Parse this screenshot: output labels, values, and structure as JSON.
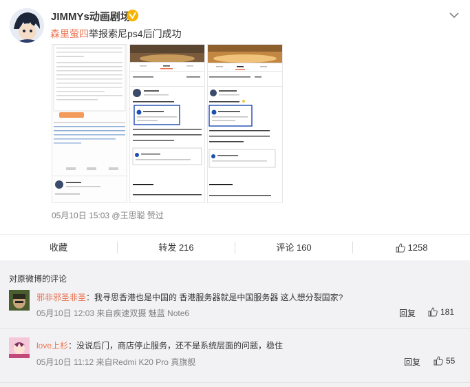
{
  "post": {
    "author": "JIMMYs动画剧场",
    "mention": "森里萤四",
    "text": "举报索尼ps4后门成功",
    "date": "05月10日 15:03",
    "liked_by": "@王思聪 赞过"
  },
  "screenshot1": {
    "link_line": "https://store.playstation.com/zh-hans-hk/home/",
    "line2": "2019-05-03",
    "emoji_line": "转发 12  评论 8",
    "reply_text": "谁说娱了啊 …",
    "commenter": "森里萤四"
  },
  "screenshot2": {
    "tab_zf": "转发",
    "tab_pl": "评论",
    "tab_dz": "赞",
    "hashtag": "#每日福利签到#",
    "count": "5月4日",
    "commenter": "森里萤四",
    "greeting": "我成功了，我成功了！！",
    "ps_name": "PlayStation中国",
    "para1": "今日PlayStation中国作微博上发文并声明，要求用户严格遵守相关服务协议，合规使用产品。",
    "title": "微博原文：",
    "para2": "为了保障PlayStation用户权益，共同"
  },
  "actions": {
    "collect": "收藏",
    "repost": "转发 216",
    "comment": "评论 160",
    "likes": "1258"
  },
  "comments_title": "对原微博的评论",
  "comments": [
    {
      "name": "邪非邪圣非圣",
      "text": "：我寻思香港也是中国的 香港服务器就是中国服务器 这人想分裂国家?",
      "time": "05月10日 12:03 来自疾速双摄 魅蓝 Note6",
      "reply": "回复",
      "likes": "181"
    },
    {
      "name": "love上杉",
      "text": "：没说后门，商店停止服务，还不是系统层面的问题，稳住",
      "time": "05月10日 11:12 来自Redmi K20 Pro 真旗舰",
      "reply": "回复",
      "likes": "55"
    }
  ],
  "colors": {
    "accent": "#eb7350",
    "badge": "#f6b400",
    "link": "#eb7350",
    "comments_bg": "#f2f2f5"
  }
}
